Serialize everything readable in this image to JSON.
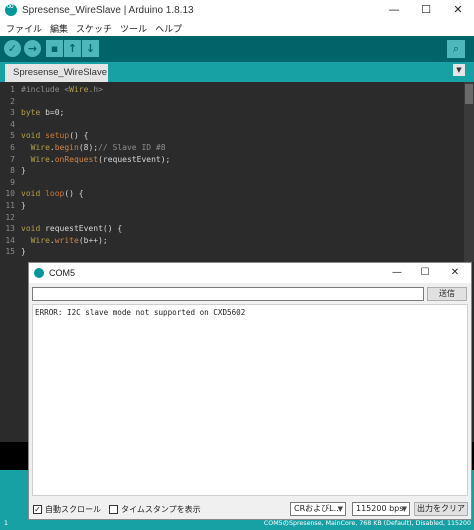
{
  "window": {
    "title": "Spresense_WireSlave | Arduino 1.8.13",
    "minimize": "—",
    "maximize": "☐",
    "close": "✕"
  },
  "menu": [
    "ファイル",
    "編集",
    "スケッチ",
    "ツール",
    "ヘルプ"
  ],
  "toolbar": {
    "verify": "✓",
    "upload": "→",
    "new": "▪",
    "open": "↑",
    "save": "↓",
    "serial_monitor": "⌕"
  },
  "tab": {
    "name": "Spresense_WireSlave",
    "menu_arrow": "▼"
  },
  "code_lines": [
    {
      "n": "1",
      "parts": [
        {
          "t": "#include <",
          "c": "cm"
        },
        {
          "t": "Wire",
          "c": "k"
        },
        {
          "t": ".h>",
          "c": "cm"
        }
      ]
    },
    {
      "n": "2",
      "parts": []
    },
    {
      "n": "3",
      "parts": [
        {
          "t": "byte",
          "c": "k"
        },
        {
          "t": " b=0;",
          "c": ""
        }
      ]
    },
    {
      "n": "4",
      "parts": []
    },
    {
      "n": "5",
      "parts": [
        {
          "t": "void",
          "c": "k"
        },
        {
          "t": " ",
          "c": ""
        },
        {
          "t": "setup",
          "c": "kw"
        },
        {
          "t": "() {",
          "c": ""
        }
      ]
    },
    {
      "n": "6",
      "parts": [
        {
          "t": "  ",
          "c": ""
        },
        {
          "t": "Wire",
          "c": "k"
        },
        {
          "t": ".",
          "c": ""
        },
        {
          "t": "begin",
          "c": "f"
        },
        {
          "t": "(8);",
          "c": ""
        },
        {
          "t": "// Slave ID #8",
          "c": "cm"
        }
      ]
    },
    {
      "n": "7",
      "parts": [
        {
          "t": "  ",
          "c": ""
        },
        {
          "t": "Wire",
          "c": "k"
        },
        {
          "t": ".",
          "c": ""
        },
        {
          "t": "onRequest",
          "c": "f"
        },
        {
          "t": "(requestEvent);",
          "c": ""
        }
      ]
    },
    {
      "n": "8",
      "parts": [
        {
          "t": "}",
          "c": ""
        }
      ]
    },
    {
      "n": "9",
      "parts": []
    },
    {
      "n": "10",
      "parts": [
        {
          "t": "void",
          "c": "k"
        },
        {
          "t": " ",
          "c": ""
        },
        {
          "t": "loop",
          "c": "kw"
        },
        {
          "t": "() {",
          "c": ""
        }
      ]
    },
    {
      "n": "11",
      "parts": [
        {
          "t": "}",
          "c": ""
        }
      ]
    },
    {
      "n": "12",
      "parts": []
    },
    {
      "n": "13",
      "parts": [
        {
          "t": "void",
          "c": "k"
        },
        {
          "t": " requestEvent() {",
          "c": ""
        }
      ]
    },
    {
      "n": "14",
      "parts": [
        {
          "t": "  ",
          "c": ""
        },
        {
          "t": "Wire",
          "c": "k"
        },
        {
          "t": ".",
          "c": ""
        },
        {
          "t": "write",
          "c": "f"
        },
        {
          "t": "(b++);",
          "c": ""
        }
      ]
    },
    {
      "n": "15",
      "parts": [
        {
          "t": "}",
          "c": ""
        }
      ]
    }
  ],
  "serial": {
    "title": "COM5",
    "minimize": "—",
    "maximize": "☐",
    "close": "✕",
    "input_value": "",
    "send_label": "送信",
    "output": "ERROR: I2C slave mode not supported on CXD5602",
    "autoscroll_label": "自動スクロール",
    "autoscroll_checked": true,
    "timestamp_label": "タイムスタンプを表示",
    "timestamp_checked": false,
    "line_ending": "CRおよびL...",
    "baud": "115200 bps",
    "clear_label": "出力をクリア"
  },
  "status": {
    "line": "1",
    "board": "COM5のSpresense, MainCore, 768 KB (Default), Disabled, 115200"
  }
}
